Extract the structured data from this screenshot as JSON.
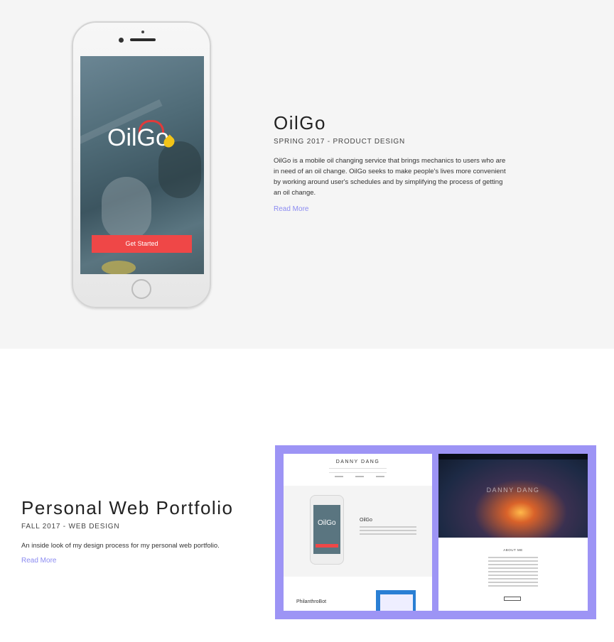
{
  "project1": {
    "phone_screen": {
      "logo_text": "OilGo",
      "button_label": "Get Started"
    },
    "title": "OilGo",
    "subtitle": "SPRING 2017 - PRODUCT DESIGN",
    "description": "OilGo is a mobile oil changing service that brings mechanics to users who are in need of an oil change. OilGo seeks to make people's lives more convenient by working around user's schedules and by simplifying the process of getting an oil change.",
    "read_more": "Read More"
  },
  "project2": {
    "title": "Personal Web Portfolio",
    "subtitle": "FALL 2017 - WEB DESIGN",
    "description": "An inside look of my design process for my personal web portfolio.",
    "read_more": "Read More",
    "mockup": {
      "left_site_name": "DANNY DANG",
      "left_project_title": "OilGo",
      "left_phone_logo": "OilGo",
      "left_second_project": "PhilanthroBot",
      "right_hero_name": "DANNY DANG",
      "right_section_title": "ABOUT ME"
    }
  },
  "colors": {
    "accent_link": "#8b8bf1",
    "button_red": "#ef4747",
    "mockup_frame": "#9d94f5",
    "section_bg": "#f5f5f5"
  }
}
